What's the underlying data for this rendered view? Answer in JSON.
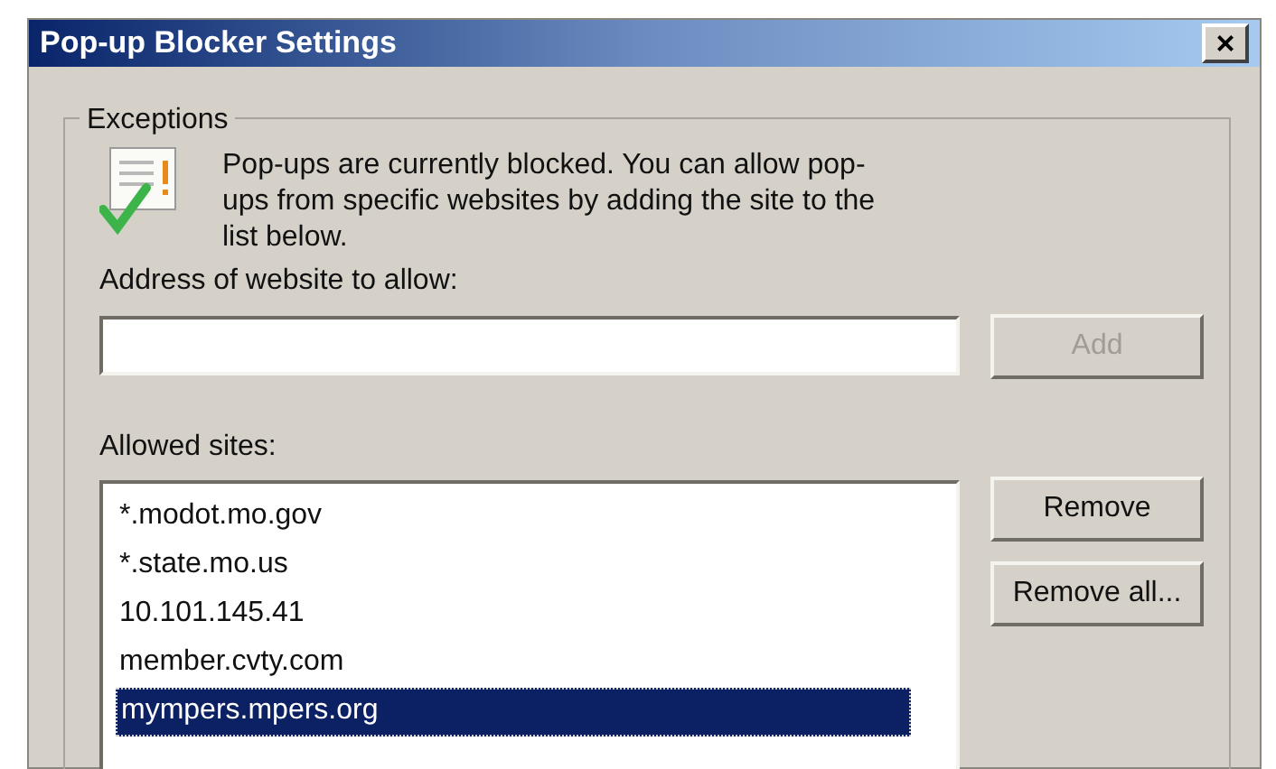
{
  "window": {
    "title": "Pop-up Blocker Settings",
    "close": "×"
  },
  "exceptions": {
    "legend": "Exceptions",
    "message": "Pop-ups are currently blocked.  You can allow pop-ups from specific websites by adding the site to the list below.",
    "address_label": "Address of website to allow:",
    "add_button": {
      "label": "Add",
      "disabled": true
    },
    "allowed_label": "Allowed sites:",
    "sites": [
      {
        "label": "*.modot.mo.gov",
        "selected": false
      },
      {
        "label": "*.state.mo.us",
        "selected": false
      },
      {
        "label": "10.101.145.41",
        "selected": false
      },
      {
        "label": "member.cvty.com",
        "selected": false
      },
      {
        "label": "mympers.mpers.org",
        "selected": true
      }
    ],
    "buttons": [
      {
        "label": "Remove",
        "disabled": false
      },
      {
        "label": "Remove all...",
        "disabled": false
      }
    ]
  }
}
